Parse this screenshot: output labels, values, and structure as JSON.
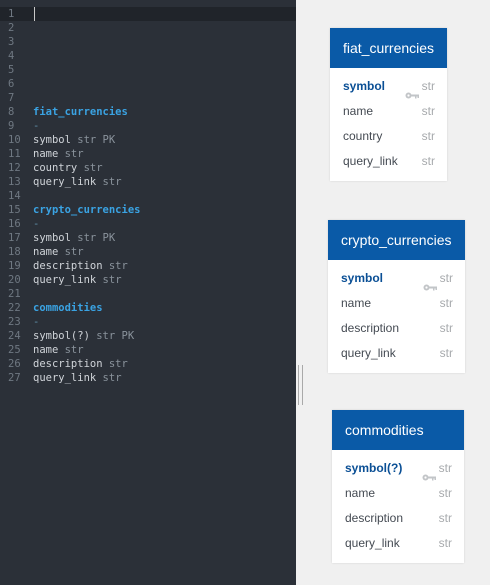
{
  "editor": {
    "lines": [
      {
        "n": "1",
        "parts": []
      },
      {
        "n": "2",
        "parts": []
      },
      {
        "n": "3",
        "parts": []
      },
      {
        "n": "4",
        "parts": []
      },
      {
        "n": "5",
        "parts": []
      },
      {
        "n": "6",
        "parts": []
      },
      {
        "n": "7",
        "parts": []
      },
      {
        "n": "8",
        "parts": [
          {
            "t": "fiat_currencies",
            "k": "tbl"
          }
        ]
      },
      {
        "n": "9",
        "parts": [
          {
            "t": "-",
            "k": "dash"
          }
        ]
      },
      {
        "n": "10",
        "parts": [
          {
            "t": "symbol ",
            "k": ""
          },
          {
            "t": "str PK",
            "k": "typ"
          }
        ]
      },
      {
        "n": "11",
        "parts": [
          {
            "t": "name ",
            "k": ""
          },
          {
            "t": "str",
            "k": "typ"
          }
        ]
      },
      {
        "n": "12",
        "parts": [
          {
            "t": "country ",
            "k": ""
          },
          {
            "t": "str",
            "k": "typ"
          }
        ]
      },
      {
        "n": "13",
        "parts": [
          {
            "t": "query_link ",
            "k": ""
          },
          {
            "t": "str",
            "k": "typ"
          }
        ]
      },
      {
        "n": "14",
        "parts": []
      },
      {
        "n": "15",
        "parts": [
          {
            "t": "crypto_currencies",
            "k": "tbl"
          }
        ]
      },
      {
        "n": "16",
        "parts": [
          {
            "t": "-",
            "k": "dash"
          }
        ]
      },
      {
        "n": "17",
        "parts": [
          {
            "t": "symbol ",
            "k": ""
          },
          {
            "t": "str PK",
            "k": "typ"
          }
        ]
      },
      {
        "n": "18",
        "parts": [
          {
            "t": "name ",
            "k": ""
          },
          {
            "t": "str",
            "k": "typ"
          }
        ]
      },
      {
        "n": "19",
        "parts": [
          {
            "t": "description ",
            "k": ""
          },
          {
            "t": "str",
            "k": "typ"
          }
        ]
      },
      {
        "n": "20",
        "parts": [
          {
            "t": "query_link ",
            "k": ""
          },
          {
            "t": "str",
            "k": "typ"
          }
        ]
      },
      {
        "n": "21",
        "parts": []
      },
      {
        "n": "22",
        "parts": [
          {
            "t": "commodities",
            "k": "tbl"
          }
        ]
      },
      {
        "n": "23",
        "parts": [
          {
            "t": "-",
            "k": "dash"
          }
        ]
      },
      {
        "n": "24",
        "parts": [
          {
            "t": "symbol(?) ",
            "k": ""
          },
          {
            "t": "str PK",
            "k": "typ"
          }
        ]
      },
      {
        "n": "25",
        "parts": [
          {
            "t": "name ",
            "k": ""
          },
          {
            "t": "str",
            "k": "typ"
          }
        ]
      },
      {
        "n": "26",
        "parts": [
          {
            "t": "description ",
            "k": ""
          },
          {
            "t": "str",
            "k": "typ"
          }
        ]
      },
      {
        "n": "27",
        "parts": [
          {
            "t": "query_link ",
            "k": ""
          },
          {
            "t": "str",
            "k": "typ"
          }
        ]
      }
    ]
  },
  "tables": [
    {
      "name": "fiat_currencies",
      "fields": [
        {
          "name": "symbol",
          "type": "str",
          "pk": true,
          "icon": "key-icon"
        },
        {
          "name": "name",
          "type": "str",
          "pk": false
        },
        {
          "name": "country",
          "type": "str",
          "pk": false
        },
        {
          "name": "query_link",
          "type": "str",
          "pk": false
        }
      ]
    },
    {
      "name": "crypto_currencies",
      "fields": [
        {
          "name": "symbol",
          "type": "str",
          "pk": true,
          "icon": "key-icon"
        },
        {
          "name": "name",
          "type": "str",
          "pk": false
        },
        {
          "name": "description",
          "type": "str",
          "pk": false
        },
        {
          "name": "query_link",
          "type": "str",
          "pk": false
        }
      ]
    },
    {
      "name": "commodities",
      "fields": [
        {
          "name": "symbol(?)",
          "type": "str",
          "pk": true,
          "icon": "key-icon"
        },
        {
          "name": "name",
          "type": "str",
          "pk": false
        },
        {
          "name": "description",
          "type": "str",
          "pk": false
        },
        {
          "name": "query_link",
          "type": "str",
          "pk": false
        }
      ]
    }
  ],
  "colors": {
    "editor_bg": "#2b3038",
    "table_name": "#3aa3e3",
    "card_header": "#0a5aa7",
    "pk_text": "#0a4f95"
  }
}
